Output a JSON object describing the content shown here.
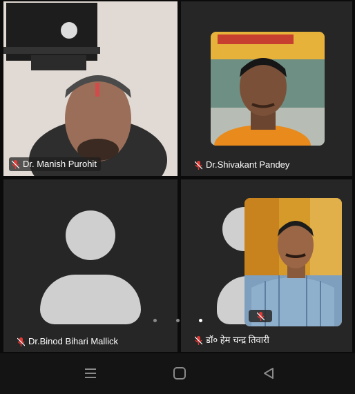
{
  "participants": [
    {
      "name": "Dr. Manish Purohit"
    },
    {
      "name": "Dr.Shivakant Pandey"
    },
    {
      "name": "Dr.Binod Bihari Mallick"
    },
    {
      "name": "डॉ० हेम चन्द्र तिवारी"
    }
  ],
  "pagination": {
    "pages": 3,
    "active": 3
  },
  "colors": {
    "background": "#0b0b0b",
    "tile": "#262626",
    "muted_mic": "#e53935",
    "avatar_placeholder": "#cfcfcf"
  },
  "nav": {
    "icons": [
      "recents-icon",
      "home-icon",
      "back-icon"
    ]
  }
}
